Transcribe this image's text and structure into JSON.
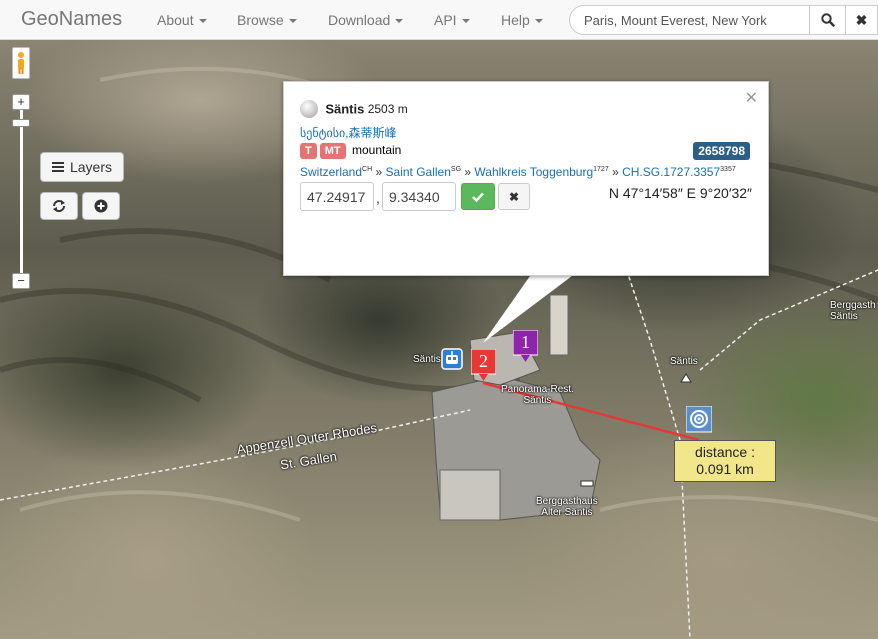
{
  "navbar": {
    "brand": "GeoNames",
    "menu": [
      {
        "label": "About"
      },
      {
        "label": "Browse"
      },
      {
        "label": "Download"
      },
      {
        "label": "API"
      },
      {
        "label": "Help"
      }
    ],
    "search_placeholder": "Paris, Mount Everest, New York"
  },
  "map_controls": {
    "layers_label": "Layers",
    "zoom_in": "+",
    "zoom_out": "−"
  },
  "popup": {
    "name": "Säntis",
    "elevation": "2503 m",
    "alt_names": "სენტისი,森蒂斯峰",
    "badges": [
      "T",
      "MT"
    ],
    "feature_type": "mountain",
    "geoname_id": "2658798",
    "hierarchy": [
      {
        "name": "Switzerland",
        "code": "CH"
      },
      {
        "name": "Saint Gallen",
        "code": "SG"
      },
      {
        "name": "Wahlkreis Toggenburg",
        "code": "1727"
      },
      {
        "name": "CH.SG.1727.3357",
        "code": "3357"
      }
    ],
    "separator": "»",
    "lat": "47.24917",
    "lng": "9.34340",
    "coord_separator": ",",
    "dms": "N 47°14′58″ E 9°20′32″"
  },
  "map_labels": {
    "region1": "Appenzell Outer Rhodes",
    "region2": "St. Gallen",
    "poi_santis_left": "Säntis",
    "poi_panorama": "Panorama-Rest.\nSäntis",
    "poi_berggasthaus": "Berggasthaus\nAlter Säntis",
    "poi_berggasthaus_right": "Berggasth\nSäntis",
    "poi_santis_peak": "Säntis"
  },
  "markers": {
    "marker1": "1",
    "marker2": "2"
  },
  "distance": {
    "label": "distance :",
    "value": "0.091 km"
  },
  "colors": {
    "link": "#1a6fb5",
    "badge_red": "#e57373",
    "id_badge": "#2c5f88",
    "ok_green": "#5cb85c",
    "distance_bg": "#f2e68a",
    "marker_purple": "#8e24aa",
    "marker_red": "#e53935",
    "route_line": "#e53935"
  }
}
